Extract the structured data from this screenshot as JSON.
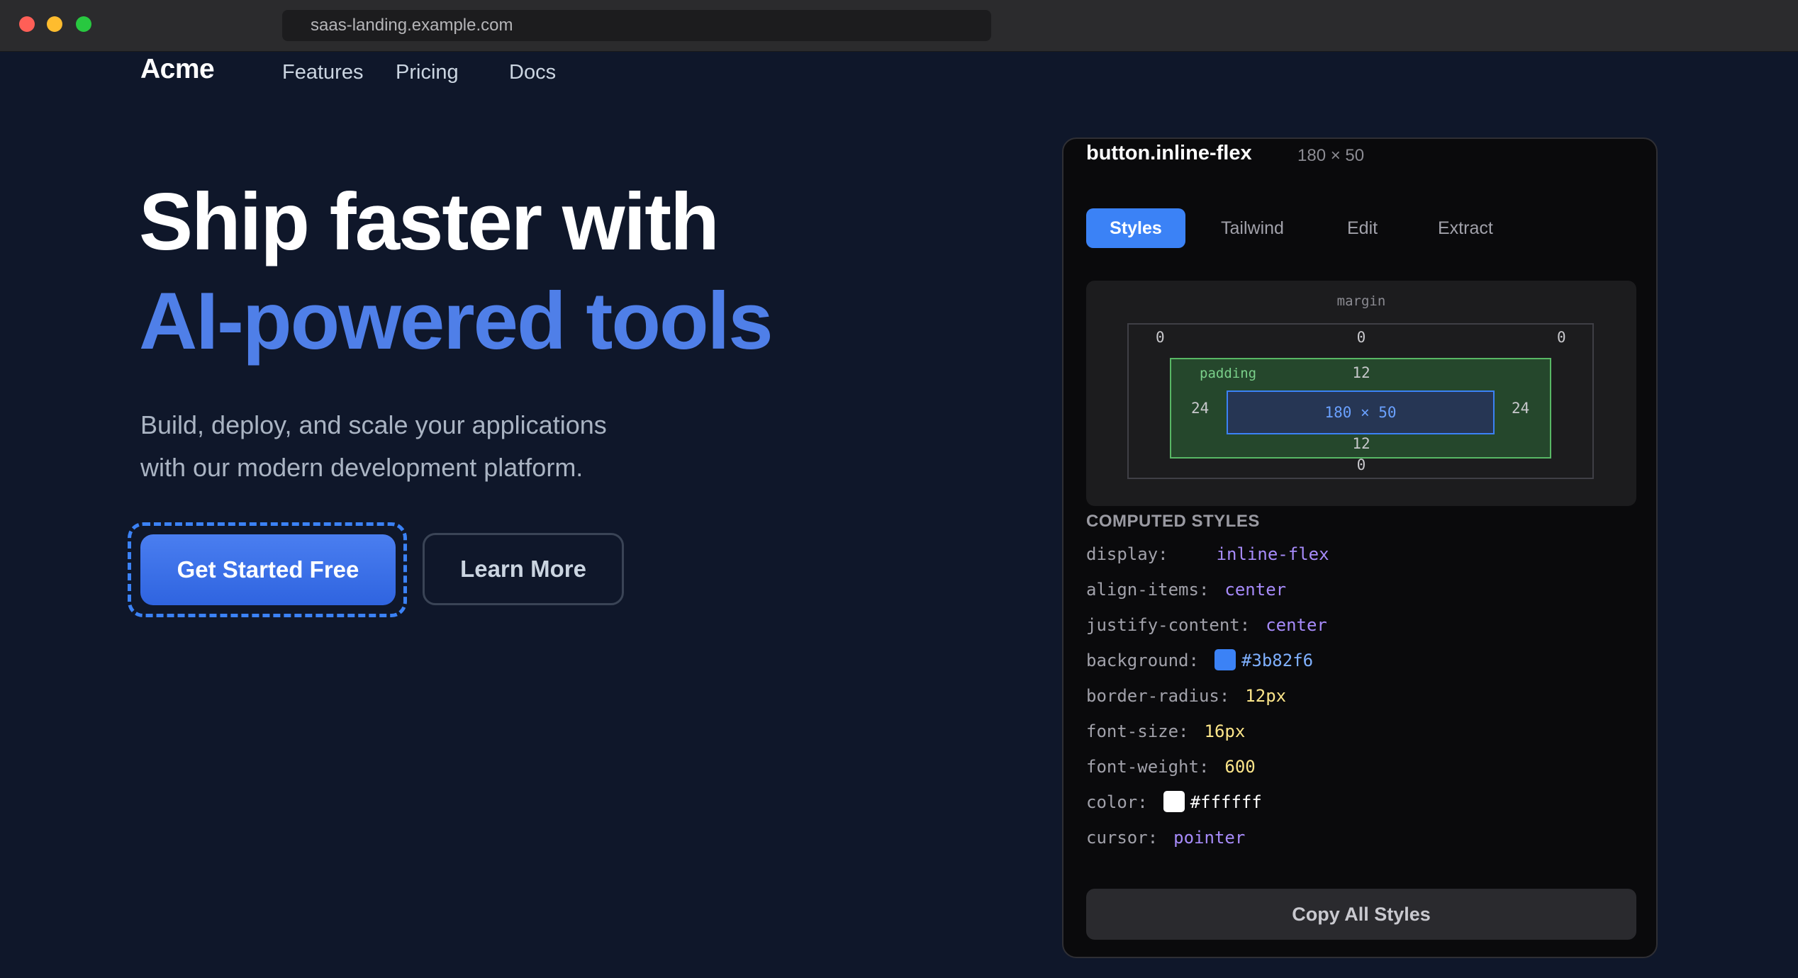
{
  "browser": {
    "url": "saas-landing.example.com"
  },
  "site": {
    "logo": "Acme",
    "nav": [
      "Features",
      "Pricing",
      "Docs"
    ],
    "hero": {
      "line1": "Ship faster with",
      "line2": "AI-powered tools",
      "sub_line1": "Build, deploy, and scale your applications",
      "sub_line2": "with our modern development platform.",
      "primary_cta": "Get Started Free",
      "secondary_cta": "Learn More"
    }
  },
  "inspector": {
    "selector": "button.inline-flex",
    "dimensions": "180 × 50",
    "tabs": [
      "Styles",
      "Tailwind",
      "Edit",
      "Extract"
    ],
    "active_tab": "Styles",
    "box_model": {
      "margin_label": "margin",
      "margin_top": "0",
      "margin_left": "0",
      "margin_right": "0",
      "margin_bottom": "0",
      "padding_label": "padding",
      "padding_top": "12",
      "padding_bottom": "12",
      "padding_left": "24",
      "padding_right": "24",
      "content": "180 × 50"
    },
    "computed_heading": "COMPUTED STYLES",
    "computed": [
      {
        "prop": "display:",
        "value": "inline-flex",
        "color": "#a78bfa"
      },
      {
        "prop": "align-items:",
        "value": "center",
        "color": "#a78bfa"
      },
      {
        "prop": "justify-content:",
        "value": "center",
        "color": "#a78bfa"
      },
      {
        "prop": "background:",
        "value": "#3b82f6",
        "color": "#7fb0ff",
        "swatch": "#3b82f6"
      },
      {
        "prop": "border-radius:",
        "value": "12px",
        "color": "#fde68a"
      },
      {
        "prop": "font-size:",
        "value": "16px",
        "color": "#fde68a"
      },
      {
        "prop": "font-weight:",
        "value": "600",
        "color": "#fde68a"
      },
      {
        "prop": "color:",
        "value": "#ffffff",
        "color": "#ffffff",
        "swatch": "#ffffff"
      },
      {
        "prop": "cursor:",
        "value": "pointer",
        "color": "#a78bfa"
      }
    ],
    "copy_button": "Copy All Styles"
  }
}
